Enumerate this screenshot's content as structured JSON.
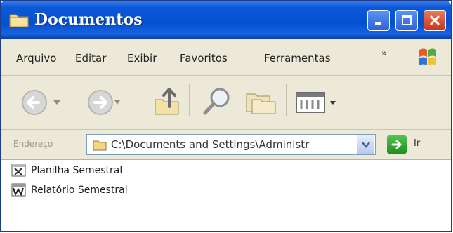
{
  "window": {
    "title": "Documentos",
    "colors": {
      "title_bar": "#0550d0",
      "chrome": "#ece9d8",
      "close_button": "#c7381b"
    }
  },
  "menu": {
    "items": [
      {
        "label": "Arquivo"
      },
      {
        "label": "Editar"
      },
      {
        "label": "Exibir"
      },
      {
        "label": "Favoritos"
      },
      {
        "label": "Ferramentas"
      }
    ],
    "overflow": "»"
  },
  "toolbar": {
    "icons": [
      "back-icon",
      "forward-icon",
      "up-folder-icon",
      "search-icon",
      "folders-icon",
      "views-icon"
    ]
  },
  "address": {
    "label": "Endereço",
    "path": "C:\\Documents and Settings\\Administr",
    "go_label": "Ir"
  },
  "files": [
    {
      "name": "Planilha Semestral",
      "icon": "excel-file-icon"
    },
    {
      "name": "Relatório Semestral",
      "icon": "word-file-icon"
    }
  ]
}
